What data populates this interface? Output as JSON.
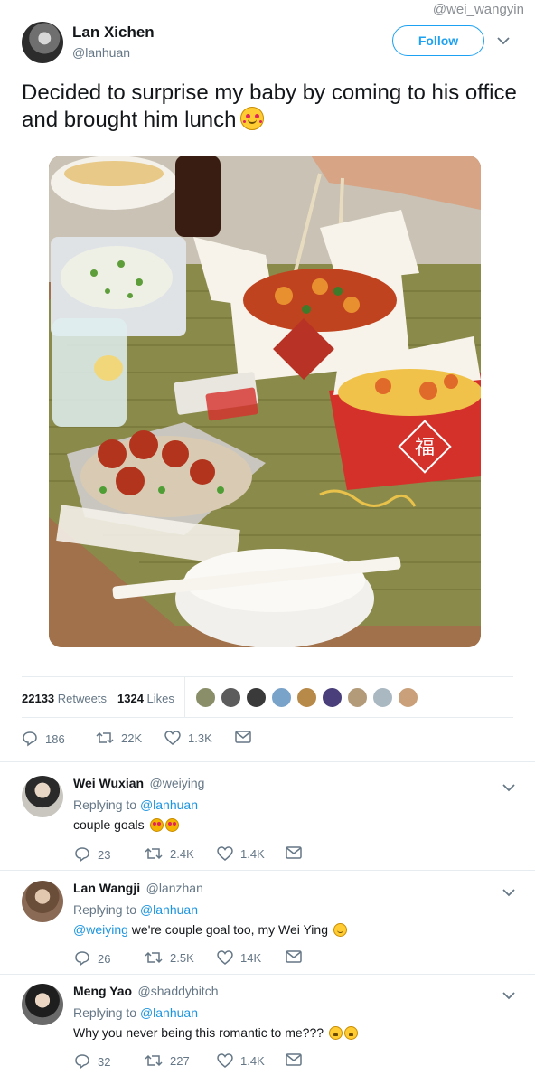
{
  "watermark": "@wei_wangyin",
  "tweet": {
    "author": {
      "display_name": "Lan Xichen",
      "handle": "@lanhuan",
      "avatar_icon": "profile-photo"
    },
    "follow_label": "Follow",
    "text": "Decided to surprise my baby by coming to his office and brought him lunch",
    "text_emoji": "smiling-face-with-hearts",
    "media": {
      "type": "photo",
      "subject": "takeout-chinese-food",
      "box_character": "福"
    },
    "stats": {
      "retweets_count": "22133",
      "retweets_label": "Retweets",
      "likes_count": "1324",
      "likes_label": "Likes"
    },
    "likers_count_shown": 9,
    "actions": {
      "replies": "186",
      "retweets": "22K",
      "likes": "1.3K"
    }
  },
  "replies": [
    {
      "display_name": "Wei Wuxian",
      "handle": "@weiying",
      "replying_prefix": "Replying to",
      "replying_to": "@lanhuan",
      "mention": "",
      "text": "couple goals",
      "emojis": [
        "heart-eyes",
        "heart-eyes"
      ],
      "actions": {
        "replies": "23",
        "retweets": "2.4K",
        "likes": "1.4K"
      }
    },
    {
      "display_name": "Lan Wangji",
      "handle": "@lanzhan",
      "replying_prefix": "Replying to",
      "replying_to": "@lanhuan",
      "mention": "@weiying",
      "text": " we're couple goal too, my Wei Ying",
      "emojis": [
        "smile"
      ],
      "actions": {
        "replies": "26",
        "retweets": "2.5K",
        "likes": "14K"
      }
    },
    {
      "display_name": "Meng Yao",
      "handle": "@shaddybitch",
      "replying_prefix": "Replying to",
      "replying_to": "@lanhuan",
      "mention": "",
      "text": "Why you never being this romantic to me???",
      "emojis": [
        "tired",
        "tired"
      ],
      "actions": {
        "replies": "32",
        "retweets": "227",
        "likes": "1.4K"
      }
    }
  ],
  "colors": {
    "accent": "#1da1f2",
    "link": "#1b95e0",
    "muted": "#657786",
    "text": "#14171a",
    "divider": "#e6ecf0"
  }
}
